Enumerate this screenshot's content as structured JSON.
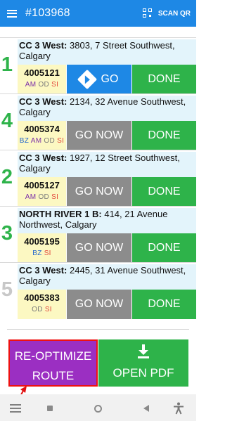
{
  "appbar": {
    "title": "#103968",
    "scan_label": "SCAN QR"
  },
  "stops": [
    {
      "number": "1",
      "company": "CC 3 West:",
      "address": " 3803, 7 Street Southwest, Calgary",
      "id": "4005121",
      "tags": [
        {
          "text": "AM",
          "color": "#7b2fa8"
        },
        {
          "text": "OD",
          "color": "#7a7a7a"
        },
        {
          "text": "SI",
          "color": "#e2463b"
        }
      ],
      "action": "GO",
      "done": "DONE"
    },
    {
      "number": "4",
      "company": "CC 3 West:",
      "address": " 2134, 32 Avenue Southwest, Calgary",
      "id": "4005374",
      "tags": [
        {
          "text": "BZ",
          "color": "#2266cc"
        },
        {
          "text": "AM",
          "color": "#7b2fa8"
        },
        {
          "text": "OD",
          "color": "#7a7a7a"
        },
        {
          "text": "SI",
          "color": "#e2463b"
        }
      ],
      "action": "GO NOW",
      "done": "DONE"
    },
    {
      "number": "2",
      "company": "CC 3 West:",
      "address": " 1927, 12 Street Southwest, Calgary",
      "id": "4005127",
      "tags": [
        {
          "text": "AM",
          "color": "#7b2fa8"
        },
        {
          "text": "OD",
          "color": "#7a7a7a"
        },
        {
          "text": "SI",
          "color": "#e2463b"
        }
      ],
      "action": "GO NOW",
      "done": "DONE"
    },
    {
      "number": "3",
      "company": "NORTH RIVER 1 B:",
      "address": " 414, 21 Avenue Northwest, Calgary",
      "id": "4005195",
      "tags": [
        {
          "text": "BZ",
          "color": "#2266cc"
        },
        {
          "text": "SI",
          "color": "#e2463b"
        }
      ],
      "action": "GO NOW",
      "done": "DONE"
    },
    {
      "number": "5",
      "company": "CC 3 West:",
      "address": " 2445, 31 Avenue Southwest, Calgary",
      "id": "4005383",
      "tags": [
        {
          "text": "OD",
          "color": "#7a7a7a"
        },
        {
          "text": "SI",
          "color": "#e2463b"
        }
      ],
      "action": "GO NOW",
      "done": "DONE"
    }
  ],
  "bottom": {
    "reoptimize_line1": "RE-OPTIMIZE",
    "reoptimize_line2": "ROUTE",
    "open_pdf": "OPEN PDF"
  },
  "colors": {
    "primary": "#1e88e5",
    "success": "#2eb34a",
    "accent": "#9b2fc2",
    "highlight": "#e11111"
  },
  "icons": [
    "menu-icon",
    "qr-code-icon",
    "directions-icon",
    "download-icon",
    "annotation-arrow-icon",
    "nav-recents-icon",
    "nav-home-icon",
    "nav-back-icon",
    "accessibility-icon"
  ]
}
